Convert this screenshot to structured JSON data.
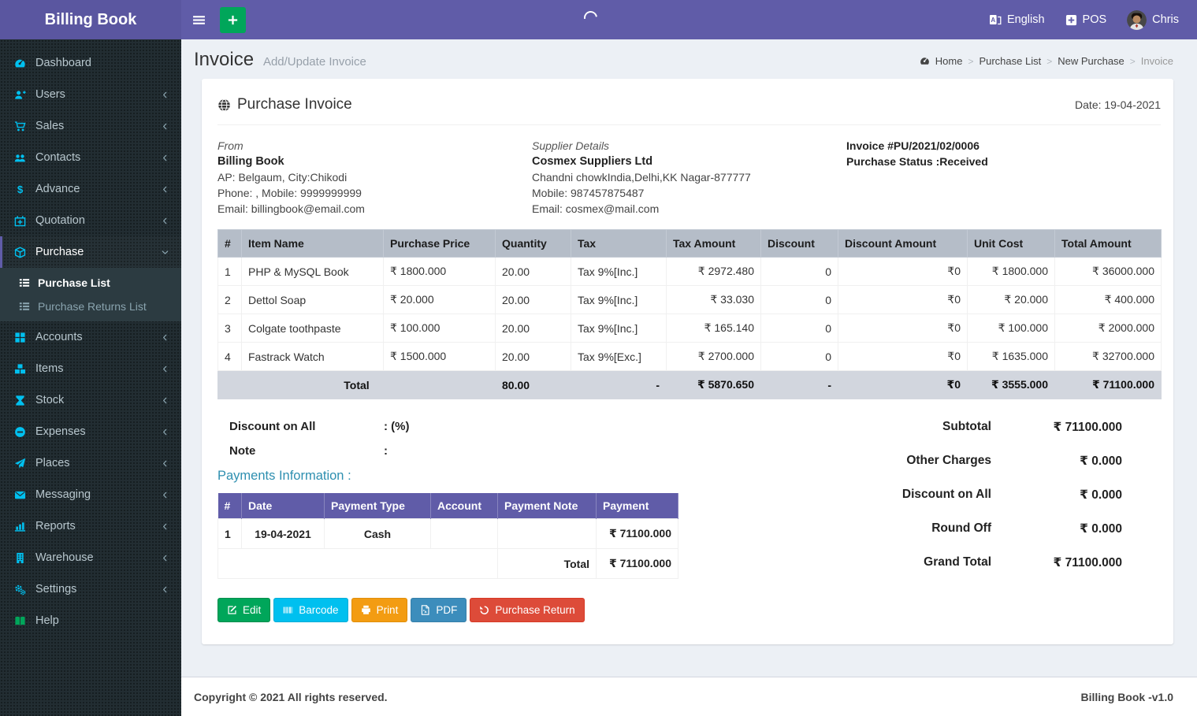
{
  "navbar": {
    "brand": "Billing Book",
    "language": "English",
    "pos": "POS",
    "user": "Chris"
  },
  "sidebar": {
    "items": [
      {
        "label": "Dashboard",
        "icon": "tachometer-icon"
      },
      {
        "label": "Users",
        "icon": "user-plus-icon"
      },
      {
        "label": "Sales",
        "icon": "cart-icon"
      },
      {
        "label": "Contacts",
        "icon": "users-icon"
      },
      {
        "label": "Advance",
        "icon": "dollar-icon"
      },
      {
        "label": "Quotation",
        "icon": "calendar-plus-icon"
      },
      {
        "label": "Purchase",
        "icon": "cube-icon",
        "state": "active-open"
      },
      {
        "label": "Accounts",
        "icon": "grid-icon"
      },
      {
        "label": "Items",
        "icon": "cubes-icon"
      },
      {
        "label": "Stock",
        "icon": "hourglass-icon"
      },
      {
        "label": "Expenses",
        "icon": "minus-circle-icon"
      },
      {
        "label": "Places",
        "icon": "paper-plane-icon"
      },
      {
        "label": "Messaging",
        "icon": "envelope-icon"
      },
      {
        "label": "Reports",
        "icon": "bar-chart-icon"
      },
      {
        "label": "Warehouse",
        "icon": "building-icon"
      },
      {
        "label": "Settings",
        "icon": "gears-icon"
      },
      {
        "label": "Help",
        "icon": "book-icon"
      }
    ],
    "submenu": [
      {
        "label": "Purchase List",
        "active": true
      },
      {
        "label": "Purchase Returns List",
        "active": false
      }
    ]
  },
  "page": {
    "title": "Invoice",
    "subtitle": "Add/Update Invoice"
  },
  "breadcrumb": {
    "items": [
      "Home",
      "Purchase List",
      "New Purchase",
      "Invoice"
    ]
  },
  "invoice": {
    "title": "Purchase Invoice",
    "date_label": "Date: 19-04-2021",
    "from": {
      "heading": "From",
      "name": "Billing Book",
      "address": "AP: Belgaum, City:Chikodi",
      "phone": "Phone: , Mobile: 9999999999",
      "email": "Email: billingbook@email.com"
    },
    "supplier": {
      "heading": "Supplier Details",
      "name": "Cosmex Suppliers Ltd",
      "address": "Chandni chowkIndia,Delhi,KK Nagar-877777",
      "mobile": "Mobile: 987457875487",
      "email": "Email: cosmex@mail.com"
    },
    "meta": {
      "number": "Invoice #PU/2021/02/0006",
      "status": "Purchase Status :Received"
    }
  },
  "items_table": {
    "headers": [
      "#",
      "Item Name",
      "Purchase Price",
      "Quantity",
      "Tax",
      "Tax Amount",
      "Discount",
      "Discount Amount",
      "Unit Cost",
      "Total Amount"
    ],
    "rows": [
      {
        "num": "1",
        "item": "PHP & MySQL Book",
        "price": "₹ 1800.000",
        "qty": "20.00",
        "tax": "Tax 9%[Inc.]",
        "tax_amount": "₹ 2972.480",
        "discount": "0",
        "discount_amount": "₹0",
        "unit_cost": "₹ 1800.000",
        "total": "₹ 36000.000"
      },
      {
        "num": "2",
        "item": "Dettol Soap",
        "price": "₹ 20.000",
        "qty": "20.00",
        "tax": "Tax 9%[Inc.]",
        "tax_amount": "₹ 33.030",
        "discount": "0",
        "discount_amount": "₹0",
        "unit_cost": "₹ 20.000",
        "total": "₹ 400.000"
      },
      {
        "num": "3",
        "item": "Colgate toothpaste",
        "price": "₹ 100.000",
        "qty": "20.00",
        "tax": "Tax 9%[Inc.]",
        "tax_amount": "₹ 165.140",
        "discount": "0",
        "discount_amount": "₹0",
        "unit_cost": "₹ 100.000",
        "total": "₹ 2000.000"
      },
      {
        "num": "4",
        "item": "Fastrack Watch",
        "price": "₹ 1500.000",
        "qty": "20.00",
        "tax": "Tax 9%[Exc.]",
        "tax_amount": "₹ 2700.000",
        "discount": "0",
        "discount_amount": "₹0",
        "unit_cost": "₹ 1635.000",
        "total": "₹ 32700.000"
      }
    ],
    "total_row": {
      "label": "Total",
      "qty": "80.00",
      "tax": "-",
      "tax_amount": "₹ 5870.650",
      "discount": "-",
      "discount_amount": "₹0",
      "unit_cost": "₹ 3555.000",
      "total": "₹ 71100.000"
    }
  },
  "discount_note": {
    "discount_label": "Discount on All",
    "discount_value": ": (%)",
    "note_label": "Note",
    "note_value": ":"
  },
  "payments": {
    "title": "Payments Information :",
    "headers": [
      "#",
      "Date",
      "Payment Type",
      "Account",
      "Payment Note",
      "Payment"
    ],
    "rows": [
      {
        "num": "1",
        "date": "19-04-2021",
        "type": "Cash",
        "account": "",
        "note": "",
        "payment": "₹ 71100.000"
      }
    ],
    "total_label": "Total",
    "total_value": "₹ 71100.000"
  },
  "summary": {
    "rows": [
      {
        "label": "Subtotal",
        "value": "₹ 71100.000"
      },
      {
        "label": "Other Charges",
        "value": "₹ 0.000"
      },
      {
        "label": "Discount on All",
        "value": "₹ 0.000"
      },
      {
        "label": "Round Off",
        "value": "₹ 0.000"
      },
      {
        "label": "Grand Total",
        "value": "₹ 71100.000"
      }
    ]
  },
  "actions": {
    "edit": "Edit",
    "barcode": "Barcode",
    "print": "Print",
    "pdf": "PDF",
    "purchase_return": "Purchase Return"
  },
  "footer": {
    "copyright": "Copyright © 2021 All rights reserved.",
    "version": "Billing Book -v1.0"
  },
  "colors": {
    "accent_purple": "#605ca8",
    "sidebar_dark": "#222d32",
    "icon_cyan": "#00c0ef",
    "success_green": "#00a65a",
    "info_cyan": "#00c0ef",
    "warning_orange": "#f39c12",
    "primary_blue": "#3c8dbc",
    "danger_red": "#dd4b39",
    "table_header_gray": "#b5bdc8",
    "total_row_gray": "#d2d6de",
    "content_bg": "#ecf0f5"
  }
}
